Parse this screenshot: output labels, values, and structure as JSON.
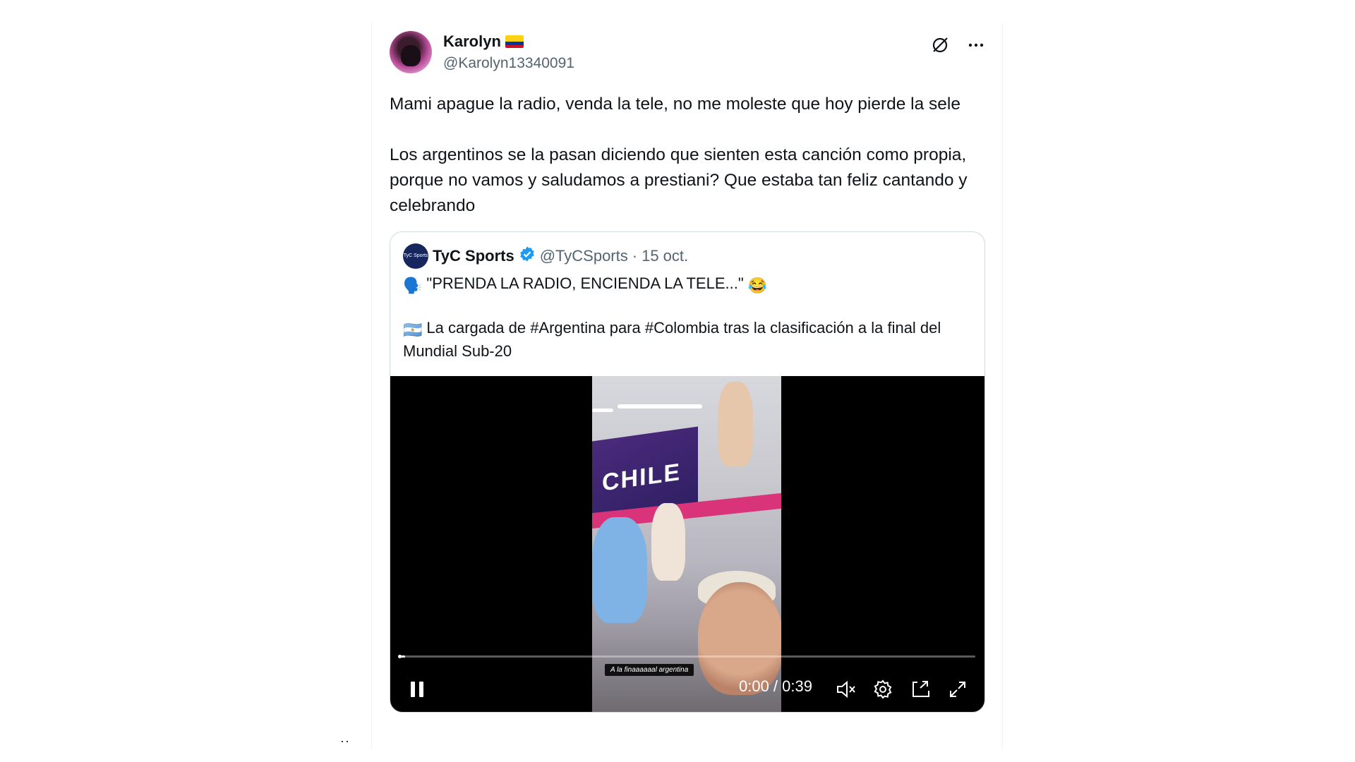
{
  "tweet": {
    "display_name": "Karolyn",
    "handle": "@Karolyn13340091",
    "text_para1": "Mami apague la radio, venda la tele, no me moleste que hoy pierde la sele",
    "text_para2": "Los argentinos se la pasan diciendo que sienten esta canción como propia, porque no vamos y saludamos a prestiani? Que estaba tan feliz cantando y celebrando"
  },
  "quote": {
    "avatar_text": "TyC Sports",
    "display_name": "TyC Sports",
    "handle": "@TyCSports",
    "separator": "·",
    "date": "15 oct.",
    "line1_emoji": "🗣️",
    "line1": "\"PRENDA LA RADIO, ENCIENDA LA TELE...\"",
    "line1_end_emoji": "😂",
    "line2_emoji": "🇦🇷",
    "line2": "La cargada de #Argentina para #Colombia tras la clasificación a la final del Mundial Sub-20"
  },
  "video": {
    "subtitle": "A la finaaaaaal argentina",
    "time": "0:00 / 0:39",
    "progress": 0.01,
    "banner_text": "CHILE"
  },
  "icons": {
    "grok": "grok-icon",
    "more": "more-icon",
    "verified": "verified-badge-icon",
    "pause": "pause-icon",
    "mute": "mute-icon",
    "settings": "settings-gear-icon",
    "pip": "picture-in-picture-icon",
    "fullscreen": "fullscreen-icon"
  },
  "colors": {
    "verified_blue": "#1d9bf0",
    "muted_text": "#536471",
    "border": "#cfd9de"
  },
  "footer": {
    "dots": "··"
  }
}
